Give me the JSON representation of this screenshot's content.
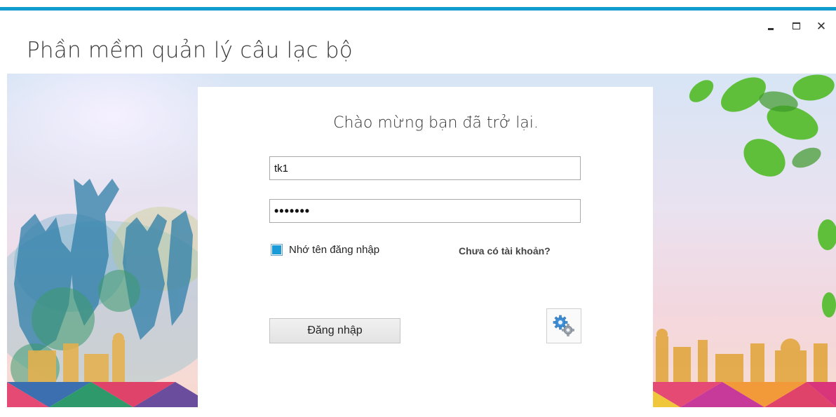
{
  "window": {
    "title": "Phần mềm quản lý câu lạc bộ",
    "controls": {
      "minimize_icon": "minimize-icon",
      "maximize_icon": "maximize-icon",
      "close_glyph": "✕"
    },
    "accent_color": "#119ccf"
  },
  "login": {
    "welcome_text": "Chào mừng bạn đã trở lại.",
    "username_value": "tk1",
    "password_masked": "•••••••",
    "remember_label": "Nhớ tên đăng nhập",
    "remember_checked": true,
    "signup_link": "Chưa có tài khoản?",
    "login_button": "Đăng nhập",
    "settings_icon": "gears-icon"
  }
}
